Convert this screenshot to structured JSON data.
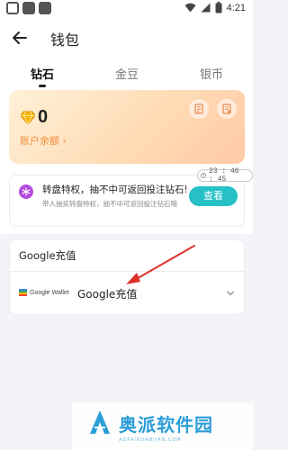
{
  "status_bar": {
    "time": "4:21"
  },
  "header": {
    "title": "钱包"
  },
  "tabs": [
    {
      "label": "钻石",
      "active": true
    },
    {
      "label": "金豆",
      "active": false
    },
    {
      "label": "银币",
      "active": false
    }
  ],
  "balance": {
    "value": "0",
    "label": "账户余额 ›"
  },
  "privilege": {
    "timer": "23 : 46 : 45",
    "title": "转盘特权，抽不中可返回投注钻石!",
    "subtitle": "带人抽奖转盘特权，抽不中可返回投注钻石哦",
    "button": "查看"
  },
  "google_pay": {
    "title": "Google充值",
    "wallet_text": "Google Wallet",
    "option_label": "Google充值"
  },
  "watermark": {
    "text": "奥派软件园",
    "sub": "AOPAIRUANJIAN.COM"
  },
  "colors": {
    "accent": "#26c0c6",
    "balance_label": "#f08c3c",
    "arrow": "#e0302a"
  }
}
